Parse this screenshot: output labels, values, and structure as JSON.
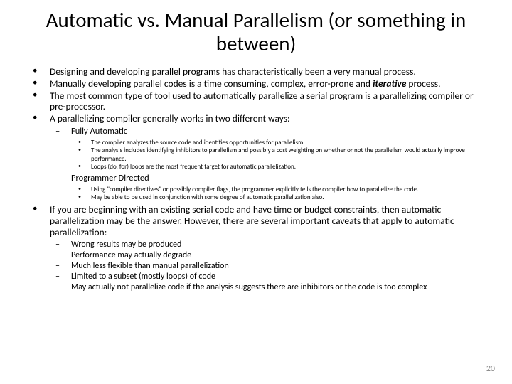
{
  "title": "Automatic vs. Manual Parallelism (or something in between)",
  "b1": "Designing and developing parallel programs has characteristically been a very manual process.",
  "b2a": "Manually developing parallel codes is a time consuming, complex, error-prone and ",
  "b2b": "iterative",
  "b2c": " process.",
  "b3": "The most common type of tool used to automatically parallelize a serial program is a parallelizing compiler or pre-processor.",
  "b4": "A parallelizing compiler generally works in two different ways:",
  "fa_title": "Fully Automatic",
  "fa1": "The compiler analyzes the source code and identifies opportunities for parallelism.",
  "fa2": "The analysis includes identifying inhibitors to parallelism and possibly a cost weighting on whether or not the parallelism would actually improve performance.",
  "fa3": "Loops (do, for) loops are the most frequent target for automatic parallelization.",
  "pd_title": "Programmer Directed",
  "pd1": "Using \"compiler directives\" or possibly compiler flags, the programmer explicitly tells the compiler how to parallelize the code.",
  "pd2": "May be able to be used in conjunction with some degree of automatic parallelization also.",
  "b5": "If you are beginning with an existing serial code and have time or budget constraints, then automatic parallelization may be the answer. However, there are several important caveats that apply to automatic parallelization:",
  "c1": "Wrong results may be produced",
  "c2": "Performance may actually degrade",
  "c3": "Much less flexible than manual parallelization",
  "c4": "Limited to a subset (mostly loops) of code",
  "c5": "May actually not parallelize code if the analysis suggests there are inhibitors or the code is too complex",
  "pagenum": "20"
}
